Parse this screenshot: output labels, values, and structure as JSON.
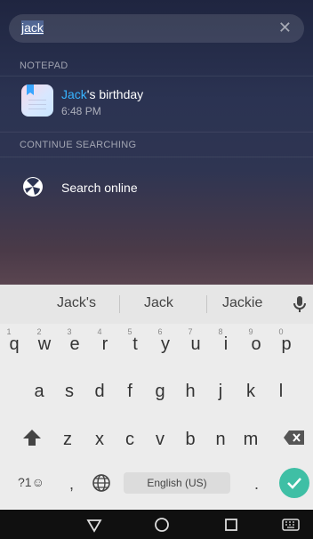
{
  "search": {
    "query": "jack",
    "clear_icon": "close-icon"
  },
  "notepad_section": {
    "title": "NOTEPAD",
    "result": {
      "title_highlight": "Jack",
      "title_rest": "'s birthday",
      "time": "6:48 PM",
      "icon": "notepad-app-icon"
    }
  },
  "continue_section": {
    "title": "CONTINUE SEARCHING",
    "search_online_label": "Search online",
    "icon": "search-online-icon"
  },
  "keyboard": {
    "suggestions": [
      "Jack's",
      "Jack",
      "Jackie"
    ],
    "mic_icon": "mic-icon",
    "row1": [
      "q",
      "w",
      "e",
      "r",
      "t",
      "y",
      "u",
      "i",
      "o",
      "p"
    ],
    "row1_hints": [
      "1",
      "2",
      "3",
      "4",
      "5",
      "6",
      "7",
      "8",
      "9",
      "0"
    ],
    "row2": [
      "a",
      "s",
      "d",
      "f",
      "g",
      "h",
      "j",
      "k",
      "l"
    ],
    "row3": [
      "z",
      "x",
      "c",
      "v",
      "b",
      "n",
      "m"
    ],
    "symbols_label": "?1☺",
    "comma_label": ",",
    "period_label": ".",
    "space_label": "English (US)",
    "shift_icon": "shift-icon",
    "backspace_icon": "backspace-icon",
    "globe_icon": "globe-icon",
    "enter_icon": "check-icon"
  },
  "navbar": {
    "back_icon": "back-triangle-icon",
    "home_icon": "home-circle-icon",
    "recents_icon": "recents-square-icon",
    "keyboard_icon": "keyboard-icon"
  },
  "colors": {
    "accent": "#37b3ff",
    "enter": "#3fbfa5"
  }
}
